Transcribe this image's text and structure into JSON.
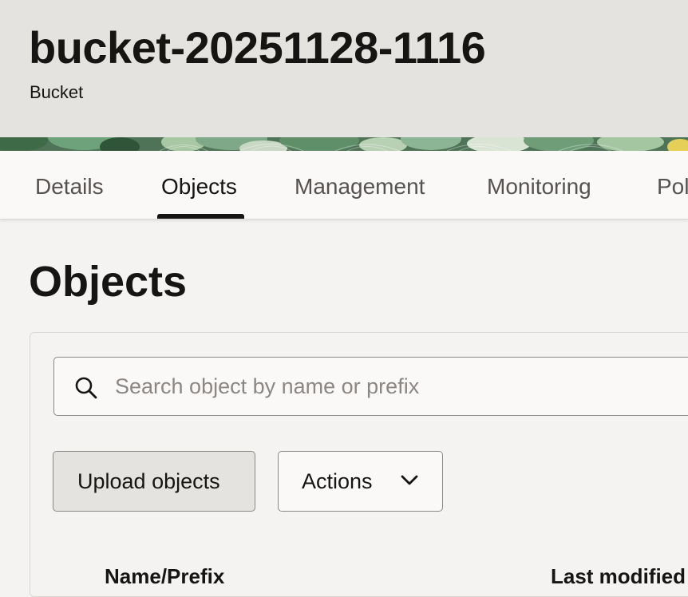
{
  "header": {
    "title": "bucket-20251128-1116",
    "subtitle": "Bucket"
  },
  "tabs": [
    {
      "label": "Details",
      "active": false
    },
    {
      "label": "Objects",
      "active": true
    },
    {
      "label": "Management",
      "active": false
    },
    {
      "label": "Monitoring",
      "active": false
    },
    {
      "label": "Pol",
      "active": false
    }
  ],
  "main": {
    "title": "Objects",
    "search": {
      "placeholder": "Search object by name or prefix",
      "value": "",
      "icon": "search-icon"
    },
    "buttons": {
      "upload_label": "Upload objects",
      "actions_label": "Actions"
    },
    "table": {
      "columns": [
        "Name/Prefix",
        "Last modified"
      ]
    }
  },
  "colors": {
    "header_bg": "#e5e3e0",
    "page_bg": "#f5f3f1",
    "banner_green": "#4e7356",
    "text": "#161513"
  }
}
